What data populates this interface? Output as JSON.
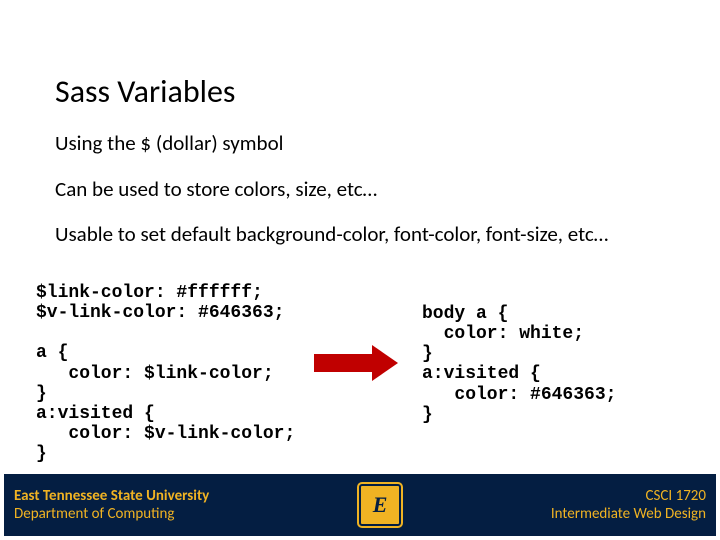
{
  "title": "Sass Variables",
  "bullets": {
    "b1": "Using the $ (dollar) symbol",
    "b2": "Can be used to store colors, size, etc…",
    "b3": "Usable to set default background-color, font-color, font-size, etc…"
  },
  "code": {
    "left": "$link-color: #ffffff;\n$v-link-color: #646363;\n\na {\n   color: $link-color;\n}\na:visited {\n   color: $v-link-color;\n}",
    "right": "body a {\n  color: white;\n}\na:visited {\n   color: #646363;\n}"
  },
  "footer": {
    "left_line1": "East Tennessee State University",
    "left_line2": "Department of Computing",
    "logo_letter": "E",
    "right_line1": "CSCI 1720",
    "right_line2": "Intermediate Web Design"
  },
  "colors": {
    "footer_bg": "#041e42",
    "footer_text": "#f0b323",
    "arrow": "#c00000"
  }
}
